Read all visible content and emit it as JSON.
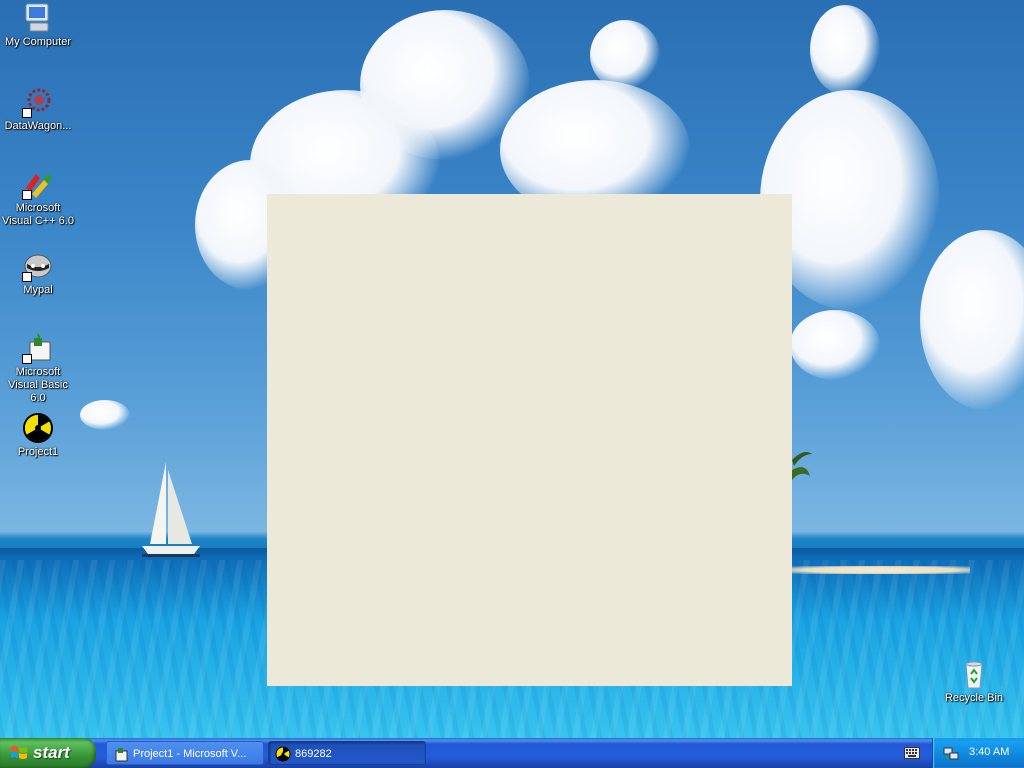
{
  "desktop": {
    "icons": [
      {
        "label": "My Computer",
        "icon": "my-computer-icon"
      },
      {
        "label": "DataWagon...",
        "icon": "datawagon-icon"
      },
      {
        "label": "Microsoft Visual C++ 6.0",
        "icon": "visual-cpp-icon"
      },
      {
        "label": "Mypal",
        "icon": "mypal-raccoon-icon"
      },
      {
        "label": "Microsoft Visual Basic 6.0",
        "icon": "visual-basic-icon"
      },
      {
        "label": "Project1",
        "icon": "radiation-icon"
      },
      {
        "label": "Recycle Bin",
        "icon": "recycle-bin-icon"
      }
    ]
  },
  "taskbar": {
    "start_label": "start",
    "tasks": [
      {
        "label": "Project1 - Microsoft V...",
        "icon": "vb-project-icon",
        "active": false
      },
      {
        "label": "869282",
        "icon": "radiation-icon",
        "active": true
      }
    ],
    "clock": "3:40 AM",
    "tray_icons": [
      "keyboard-icon",
      "network-icon"
    ]
  },
  "colors": {
    "window_bg": "#ece9d8",
    "taskbar_blue": "#245edc",
    "start_green": "#379437",
    "tray_blue": "#0f86dd"
  }
}
